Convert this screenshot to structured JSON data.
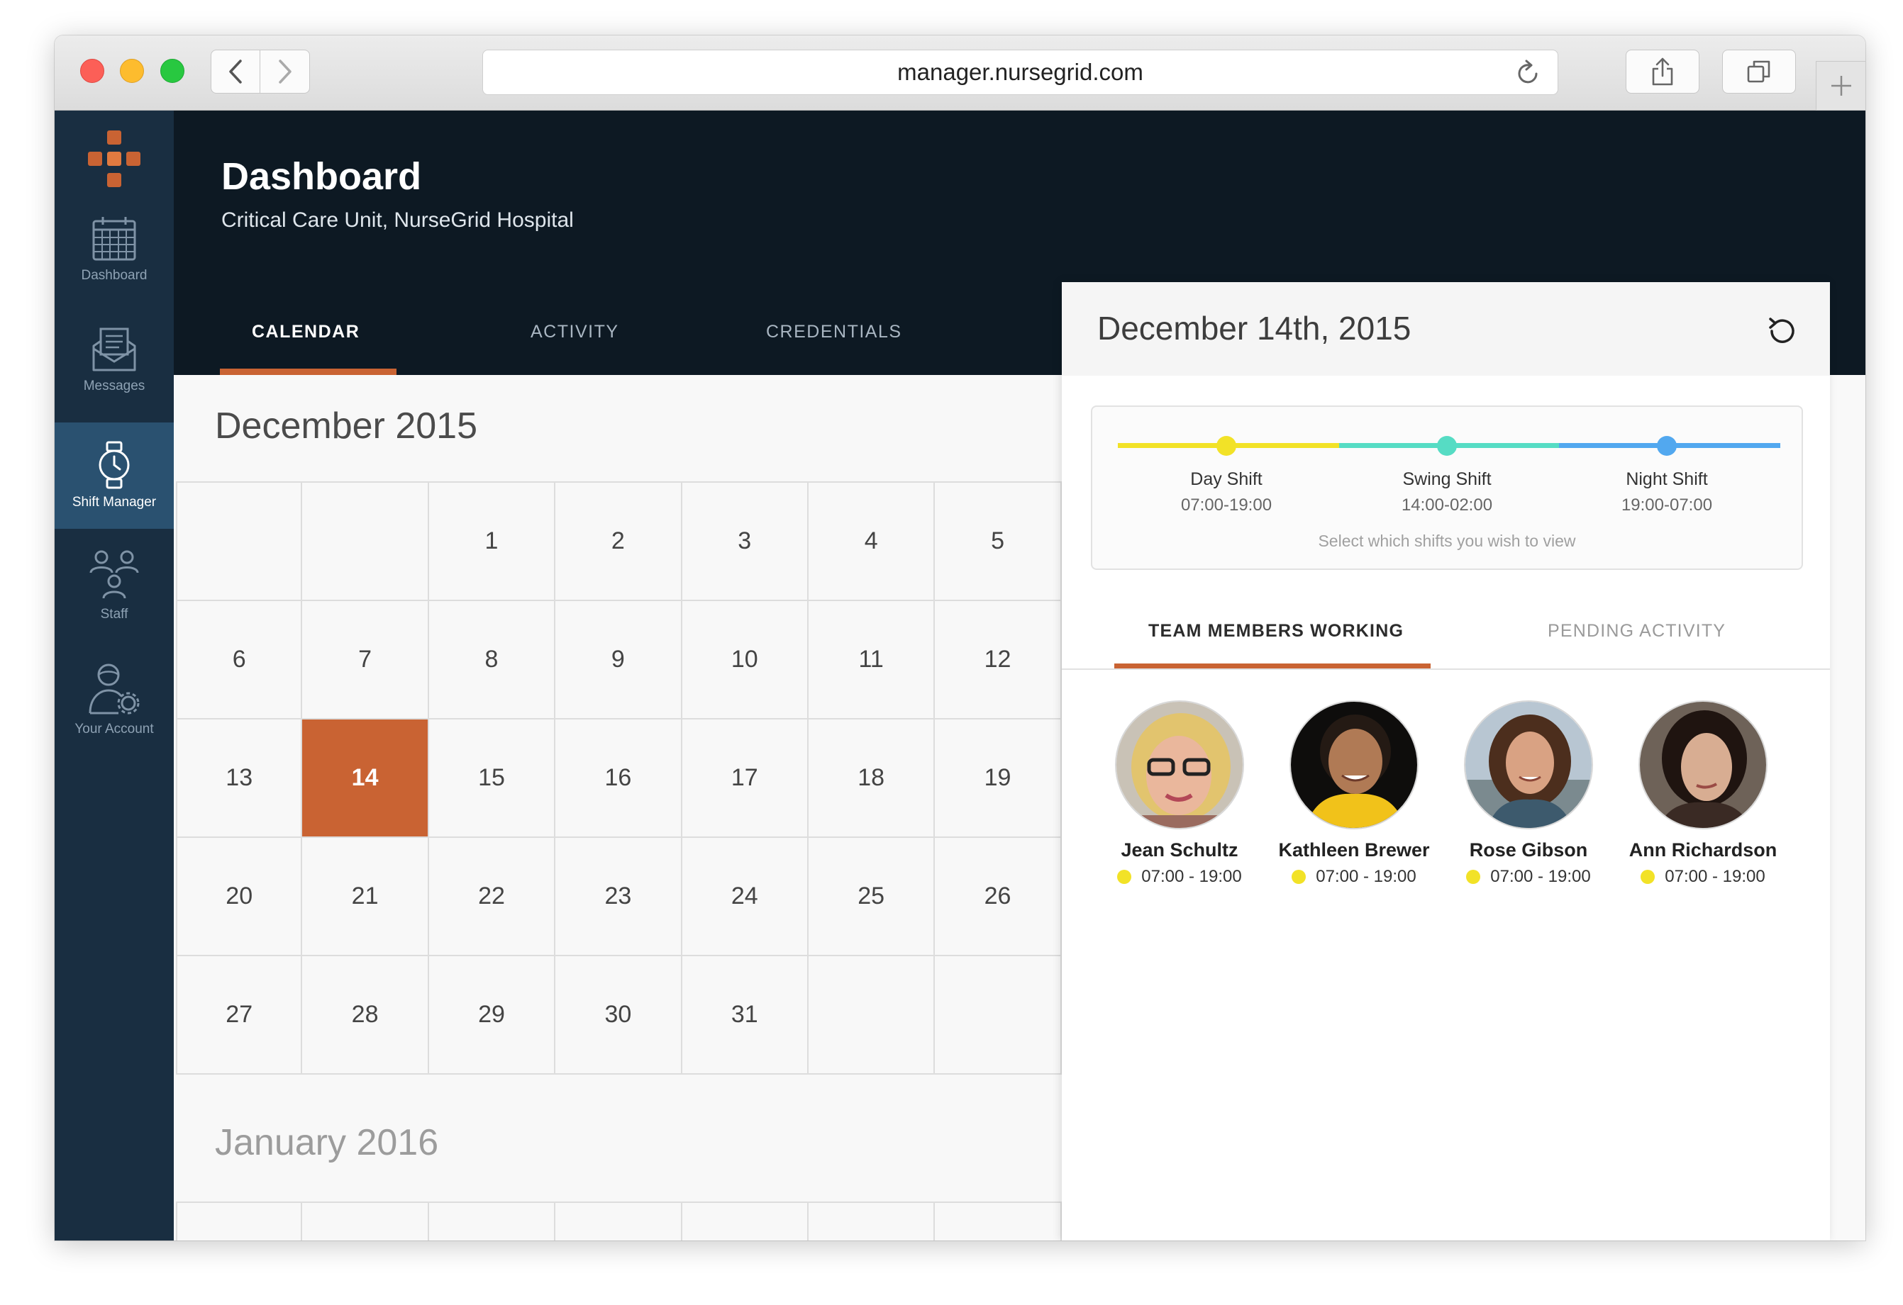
{
  "browser": {
    "url": "manager.nursegrid.com"
  },
  "sidebar": {
    "items": [
      {
        "label": "Dashboard",
        "icon": "calendar-icon"
      },
      {
        "label": "Messages",
        "icon": "messages-icon"
      },
      {
        "label": "Shift Manager",
        "icon": "watch-icon",
        "active": true
      },
      {
        "label": "Staff",
        "icon": "staff-icon"
      },
      {
        "label": "Your Account",
        "icon": "account-gear-icon"
      }
    ]
  },
  "header": {
    "title": "Dashboard",
    "subtitle": "Critical Care Unit, NurseGrid Hospital",
    "tabs": [
      {
        "label": "CALENDAR",
        "active": true
      },
      {
        "label": "ACTIVITY",
        "active": false
      },
      {
        "label": "CREDENTIALS",
        "active": false
      }
    ]
  },
  "calendar": {
    "month": "December 2015",
    "weeks": [
      [
        "",
        "",
        "1",
        "2",
        "3",
        "4",
        "5"
      ],
      [
        "6",
        "7",
        "8",
        "9",
        "10",
        "11",
        "12"
      ],
      [
        "13",
        "14",
        "15",
        "16",
        "17",
        "18",
        "19"
      ],
      [
        "20",
        "21",
        "22",
        "23",
        "24",
        "25",
        "26"
      ],
      [
        "27",
        "28",
        "29",
        "30",
        "31",
        "",
        ""
      ]
    ],
    "selected_day": "14",
    "next_month": "January 2016"
  },
  "panel": {
    "date": "December 14th, 2015",
    "shifts": [
      {
        "name": "Day Shift",
        "time": "07:00-19:00",
        "color": "#f2e227"
      },
      {
        "name": "Swing Shift",
        "time": "14:00-02:00",
        "color": "#56dcc4"
      },
      {
        "name": "Night Shift",
        "time": "19:00-07:00",
        "color": "#52a8ef"
      }
    ],
    "shift_hint": "Select which shifts you wish to view",
    "tabs": [
      {
        "label": "TEAM MEMBERS WORKING",
        "active": true
      },
      {
        "label": "PENDING ACTIVITY",
        "active": false
      }
    ],
    "members": [
      {
        "name": "Jean Schultz",
        "time": "07:00 - 19:00"
      },
      {
        "name": "Kathleen Brewer",
        "time": "07:00 - 19:00"
      },
      {
        "name": "Rose Gibson",
        "time": "07:00 - 19:00"
      },
      {
        "name": "Ann Richardson",
        "time": "07:00 - 19:00"
      }
    ]
  },
  "colors": {
    "accent": "#c96333",
    "sidebar": "#192e41",
    "header": "#0d1923",
    "day_shift": "#f2e227"
  }
}
